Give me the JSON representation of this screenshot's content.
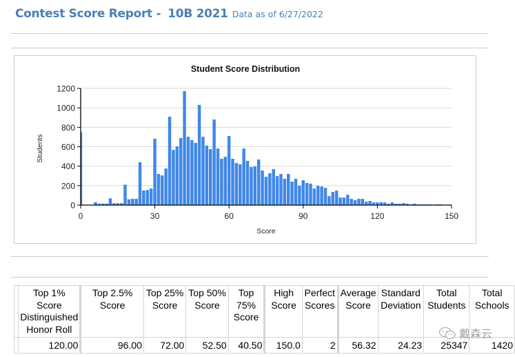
{
  "header": {
    "title": "Contest Score Report -",
    "contest": "10B 2021",
    "data_as_of": "Data as of 6/27/2022"
  },
  "colors": {
    "header_text": "#4a7fb5",
    "bar": "#4188e8",
    "gridline": "#d9d9d9",
    "border": "#cccccc"
  },
  "chart_data": {
    "type": "bar",
    "title": "Student Score Distribution",
    "xlabel": "Score",
    "ylabel": "Students",
    "xlim": [
      0,
      150
    ],
    "ylim": [
      0,
      1200
    ],
    "xticks": [
      0,
      30,
      60,
      90,
      120,
      150
    ],
    "yticks": [
      0,
      200,
      400,
      600,
      800,
      1000,
      1200
    ],
    "grid": true,
    "legend": "none",
    "series": [
      {
        "name": "Students",
        "x": [
          0,
          6,
          7.5,
          9,
          10.5,
          12,
          13.5,
          15,
          16.5,
          18,
          19.5,
          21,
          22.5,
          24,
          25.5,
          27,
          28.5,
          30,
          31.5,
          33,
          34.5,
          36,
          37.5,
          39,
          40.5,
          42,
          43.5,
          45,
          46.5,
          48,
          49.5,
          51,
          52.5,
          54,
          55.5,
          57,
          58.5,
          60,
          61.5,
          63,
          64.5,
          66,
          67.5,
          69,
          70.5,
          72,
          73.5,
          75,
          76.5,
          78,
          79.5,
          81,
          82.5,
          84,
          85.5,
          87,
          88.5,
          90,
          91.5,
          93,
          94.5,
          96,
          97.5,
          99,
          100.5,
          102,
          103.5,
          105,
          106.5,
          108,
          109.5,
          111,
          112.5,
          114,
          115.5,
          117,
          118.5,
          120,
          121.5,
          123,
          124.5,
          126,
          127.5,
          129,
          130.5,
          132,
          133.5,
          135,
          136.5,
          138,
          139.5,
          141,
          144,
          145.5,
          150
        ],
        "values": [
          750,
          30,
          15,
          15,
          15,
          70,
          20,
          20,
          20,
          210,
          60,
          65,
          65,
          440,
          150,
          155,
          170,
          682,
          320,
          305,
          376,
          909,
          568,
          604,
          689,
          1172,
          703,
          668,
          639,
          1030,
          703,
          611,
          575,
          880,
          582,
          476,
          497,
          710,
          476,
          433,
          419,
          582,
          455,
          391,
          398,
          469,
          355,
          291,
          327,
          369,
          298,
          320,
          270,
          320,
          241,
          270,
          199,
          256,
          227,
          220,
          170,
          199,
          192,
          178,
          92,
          135,
          149,
          78,
          78,
          106,
          64,
          50,
          64,
          64,
          35,
          43,
          28,
          28,
          28,
          28,
          14,
          28,
          14,
          14,
          21,
          14,
          7,
          14,
          7,
          7,
          7,
          7,
          7,
          7,
          7
        ]
      }
    ]
  },
  "stats_table": {
    "headers": [
      [
        "Top 1%",
        "Score",
        "Distinguished",
        "Honor Roll"
      ],
      [
        "Top 2.5%",
        "Score"
      ],
      [
        "Top 25%",
        "Score"
      ],
      [
        "Top 50%",
        "Score"
      ],
      [
        "Top",
        "75%",
        "Score"
      ],
      [
        "High",
        "Score"
      ],
      [
        "Perfect",
        "Scores"
      ],
      [
        "Average",
        "Score"
      ],
      [
        "Standard",
        "Deviation"
      ],
      [
        "Total",
        "Students"
      ],
      [
        "Total",
        "Schools"
      ]
    ],
    "values": [
      "120.00",
      "96.00",
      "72.00",
      "52.50",
      "40.50",
      "150.0",
      "2",
      "56.32",
      "24.23",
      "25347",
      "1420"
    ]
  },
  "watermark": {
    "icon": "wechat-icon",
    "text": "戴森云"
  }
}
